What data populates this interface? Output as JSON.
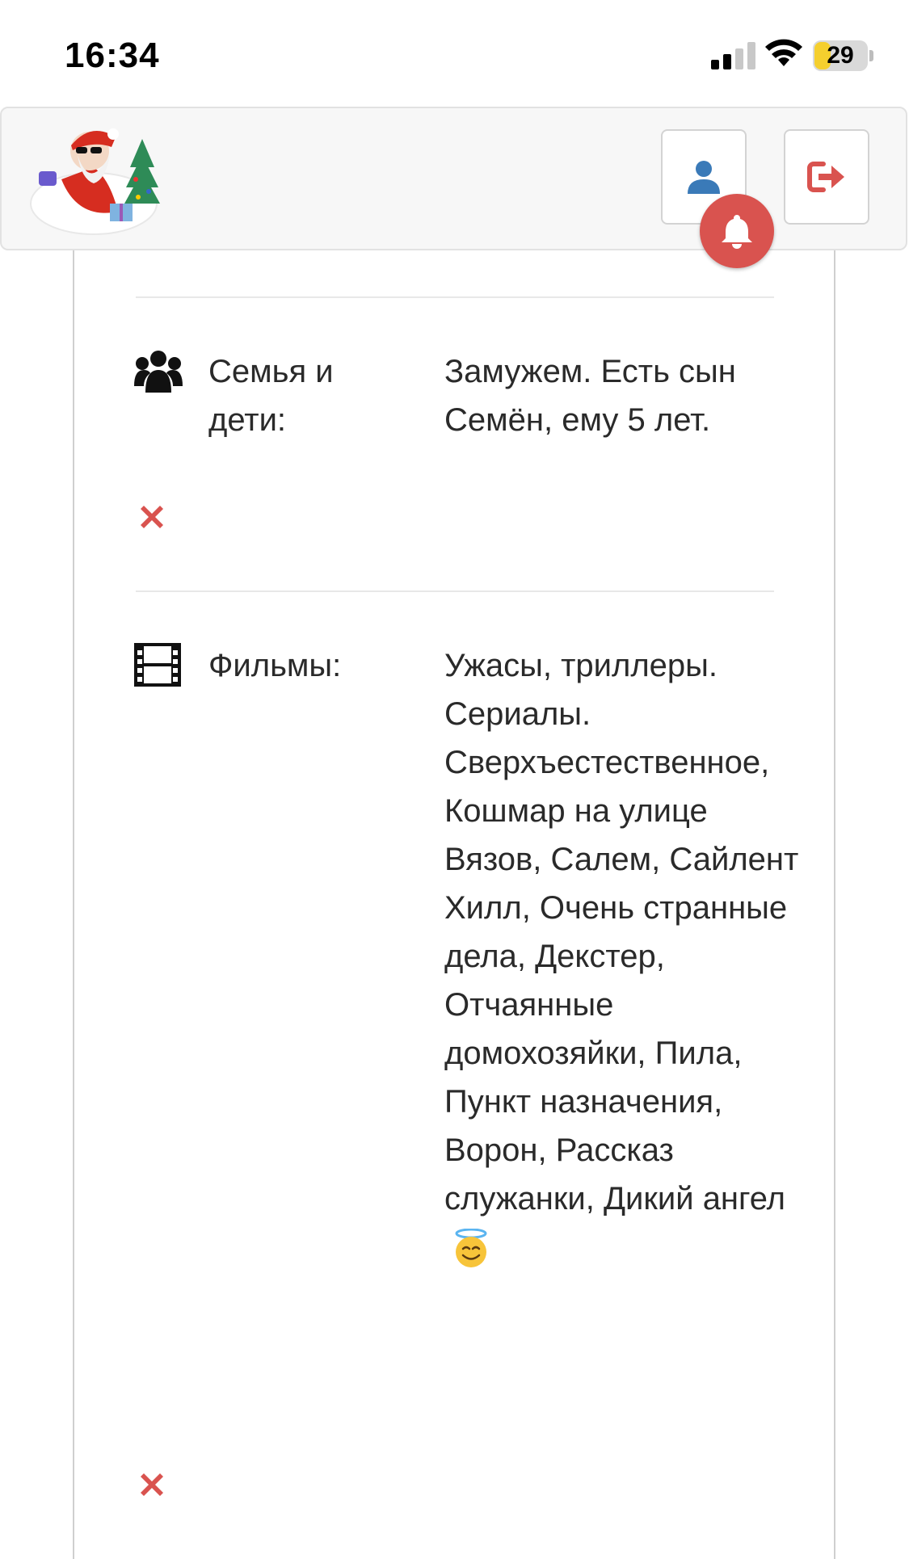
{
  "status_bar": {
    "time": "16:34",
    "battery": "29",
    "battery_color": "#f5cf2e"
  },
  "header": {
    "logo_icon": "santa-logo-icon",
    "profile_icon": "user-icon",
    "logout_icon": "sign-out-icon",
    "notification_icon": "bell-icon",
    "accent_color": "#d9534f",
    "profile_color": "#3a7ab8"
  },
  "sections": [
    {
      "icon": "family-icon",
      "label": "Семья и дети:",
      "value": "Замужем. Есть сын Семён, ему 5 лет.",
      "remove_icon": "remove-icon"
    },
    {
      "icon": "film-icon",
      "label": "Фильмы:",
      "value": "Ужасы, триллеры. Сериалы. Сверхъестественное, Кошмар на улице Вязов, Салем, Сайлент Хилл, Очень странные дела, Декстер, Отчаянные домохозяйки, Пила, Пункт назначения, Ворон, Рассказ служанки, Дикий ангел",
      "emoji": "smiling-face-with-halo",
      "remove_icon": "remove-icon"
    }
  ]
}
